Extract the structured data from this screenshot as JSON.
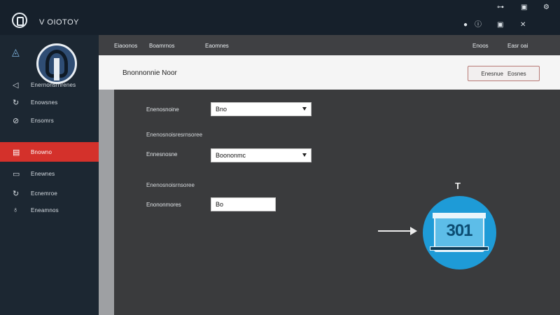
{
  "app": {
    "title": "V OIOTOY"
  },
  "topbar": {
    "icons_top": [
      "link-icon",
      "image-icon",
      "gear-icon"
    ],
    "icons_bottom": [
      "circle-icon",
      "info-icon",
      "image-icon",
      "close-icon"
    ]
  },
  "sidebar": {
    "items": [
      {
        "label": "Enernonsrnrenes",
        "icon": "alert-icon"
      },
      {
        "label": "Enowsnes",
        "icon": "refresh-icon"
      },
      {
        "label": "Ensomrs",
        "icon": "search-icon"
      },
      {
        "label": "Bnowno",
        "icon": "document-icon",
        "active": true
      },
      {
        "label": "Enewnes",
        "icon": "layers-icon"
      },
      {
        "label": "Ecnemroe",
        "icon": "refresh-icon"
      },
      {
        "label": "Eneamnos",
        "icon": "user-icon"
      }
    ]
  },
  "subheader": {
    "nav": [
      "Eiaoonos",
      "Boamrnos",
      "Eaomnes"
    ],
    "right": [
      "Enoos",
      "Easr oai"
    ]
  },
  "header": {
    "title": "Bnonnonnie Noor",
    "button_label": "Enesnue",
    "button_label_2": "Eosnes"
  },
  "form": {
    "field1_label": "Enenosnoine",
    "field1_value": "Bno",
    "section2_label": "Enenosnoisresrnsoree",
    "field2_label": "Ennesnosne",
    "field2_value": "Boononmc",
    "section3_label": "Enenosnoisrnsoree",
    "field3_label": "Enononmores",
    "field3_value": "Bo"
  },
  "graphic": {
    "marker": "T",
    "number": "301",
    "accent": "#1e9bd7"
  },
  "colors": {
    "topbar": "#16202b",
    "sidebar": "#1c2732",
    "active_item": "#d4312b",
    "main": "#3a3b3d"
  }
}
